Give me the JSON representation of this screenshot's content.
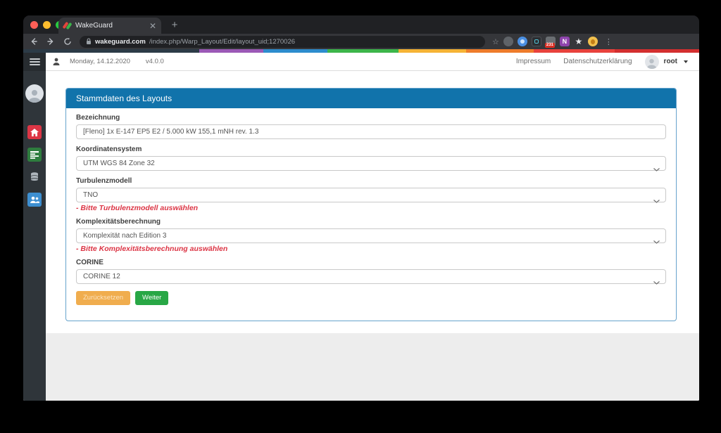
{
  "browser": {
    "tab_title": "WakeGuard",
    "url_domain": "wakeguard.com",
    "url_path": "/index.php/Warp_Layout/Edit/layout_uid;1270026",
    "extension_badge": "231"
  },
  "stripe": {
    "segments": [
      {
        "color": "#2c3b47",
        "width": "26%"
      },
      {
        "color": "#9b59b6",
        "width": "9.5%"
      },
      {
        "color": "#2d8ccd",
        "width": "9.5%"
      },
      {
        "color": "#3cb54a",
        "width": "10.5%"
      },
      {
        "color": "#f5b335",
        "width": "10%"
      },
      {
        "color": "#ee7c2b",
        "width": "10%"
      },
      {
        "color": "#e8423c",
        "width": "12%"
      },
      {
        "color": "#d32f2f",
        "width": "12.5%"
      }
    ]
  },
  "app_header": {
    "date": "Monday, 14.12.2020",
    "version": "v4.0.0",
    "link_impressum": "Impressum",
    "link_datenschutz": "Datenschutzerklärung",
    "username": "root"
  },
  "sidebar": {
    "icons": [
      "user-avatar",
      "home",
      "layout-table",
      "database",
      "users-group"
    ],
    "colors": {
      "home": "#dc3545",
      "layout_table": "#2e7d3e",
      "users_group": "#3d8fd1"
    }
  },
  "card": {
    "title": "Stammdaten des Layouts",
    "fields": [
      {
        "label": "Bezeichnung",
        "type": "input",
        "value": "[Fleno] 1x E-147 EP5 E2 / 5.000 kW 155,1 mNH rev. 1.3"
      },
      {
        "label": "Koordinatensystem",
        "type": "select",
        "value": "UTM WGS 84 Zone 32"
      },
      {
        "label": "Turbulenzmodell",
        "type": "select",
        "value": "TNO",
        "error": "- Bitte Turbulenzmodell auswählen"
      },
      {
        "label": "Komplexitätsberechnung",
        "type": "select",
        "value": "Komplexität nach Edition 3",
        "error": "- Bitte Komplexitätsberechnung auswählen"
      },
      {
        "label": "CORINE",
        "type": "select",
        "value": "CORINE 12"
      }
    ],
    "buttons": {
      "reset": "Zurücksetzen",
      "next": "Weiter"
    }
  },
  "colors": {
    "card_header_blue": "#1173ab",
    "error_red": "#dc3545",
    "button_reset_orange": "#f0ad4e",
    "button_next_green": "#28a745"
  }
}
